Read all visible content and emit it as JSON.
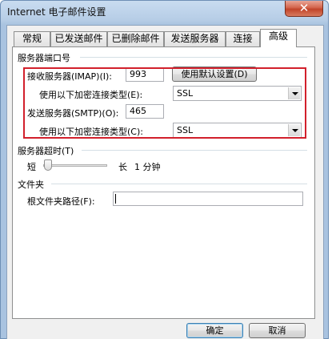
{
  "window": {
    "title": "Internet 电子邮件设置",
    "close_glyph": "✕"
  },
  "tabs": [
    {
      "label": "常规"
    },
    {
      "label": "已发送邮件"
    },
    {
      "label": "已删除邮件"
    },
    {
      "label": "发送服务器"
    },
    {
      "label": "连接"
    },
    {
      "label": "高级"
    }
  ],
  "active_tab": "高级",
  "ports": {
    "group_label": "服务器端口号",
    "imap_label": "接收服务器(IMAP)(I):",
    "imap_value": "993",
    "default_button": "使用默认设置(D)",
    "imap_encryption_label": "使用以下加密连接类型(E):",
    "imap_encryption_value": "SSL",
    "smtp_label": "发送服务器(SMTP)(O):",
    "smtp_value": "465",
    "smtp_encryption_label": "使用以下加密连接类型(C):",
    "smtp_encryption_value": "SSL"
  },
  "timeout": {
    "group_label": "服务器超时(T)",
    "short_label": "短",
    "long_label": "长",
    "value_text": "1 分钟"
  },
  "folders": {
    "group_label": "文件夹",
    "root_path_label": "根文件夹路径(F):",
    "root_path_value": ""
  },
  "footer": {
    "ok_button": "确定",
    "cancel_button": "取消"
  }
}
